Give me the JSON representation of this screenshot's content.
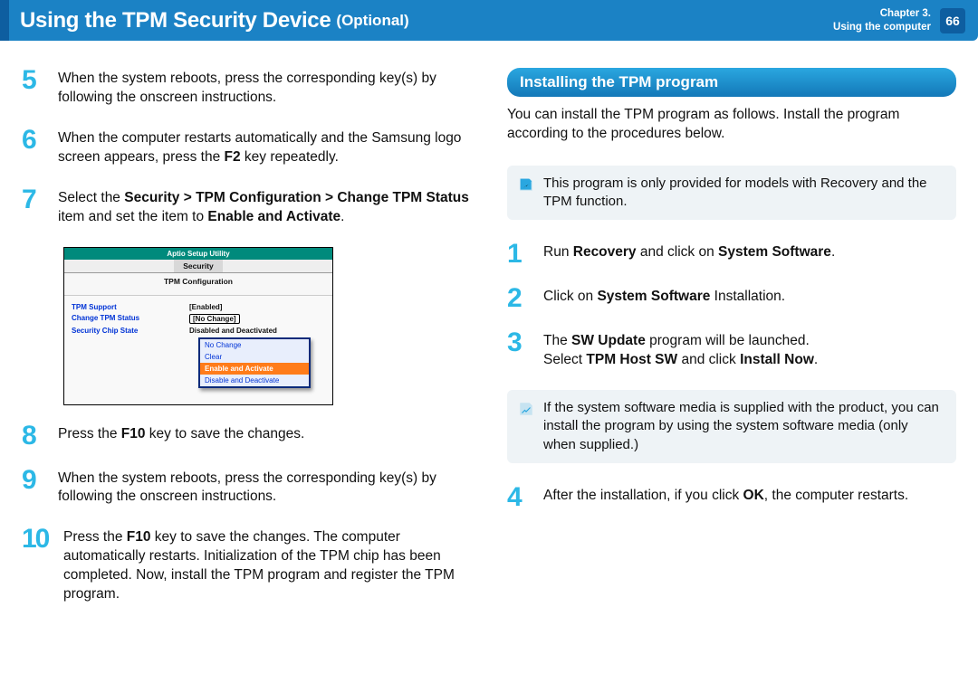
{
  "header": {
    "title": "Using the TPM Security Device",
    "subtitle": "(Optional)",
    "chapter_line1": "Chapter 3.",
    "chapter_line2": "Using the computer",
    "page_number": "66"
  },
  "left": {
    "step5": "When the system reboots, press the corresponding key(s) by following the onscreen instructions.",
    "step6_a": "When the computer restarts automatically and the Samsung logo screen appears, press the ",
    "step6_b": "F2",
    "step6_c": " key repeatedly.",
    "step7_a": "Select the ",
    "step7_b": "Security > TPM Configuration > Change TPM Status",
    "step7_c": " item and set the item to ",
    "step7_d": "Enable and Activate",
    "step7_e": ".",
    "step8_a": "Press the ",
    "step8_b": "F10",
    "step8_c": " key to save the changes.",
    "step9": "When the system reboots, press the corresponding key(s) by following the onscreen instructions.",
    "step10_a": "Press the ",
    "step10_b": "F10",
    "step10_c": " key to save the changes. The computer automatically restarts. Initialization of the TPM chip has been completed. Now, install the TPM program and register the TPM program."
  },
  "bios": {
    "util_title": "Aptio Setup Utility",
    "tab": "Security",
    "sub": "TPM Configuration",
    "r1l": "TPM Support",
    "r1v": "[Enabled]",
    "r2l": "Change TPM Status",
    "r2v": "[No Change]",
    "r3l": "Security Chip State",
    "r3v": "Disabled and Deactivated",
    "m1": "No Change",
    "m2": "Clear",
    "m3": "Enable and Activate",
    "m4": "Disable and Deactivate"
  },
  "right": {
    "section": "Installing the TPM program",
    "intro": "You can install the TPM program as follows. Install the program according to the procedures below.",
    "note1": "This program is only provided for models with Recovery  and the TPM function.",
    "step1_a": "Run ",
    "step1_b": "Recovery",
    "step1_c": " and click on ",
    "step1_d": "System Software",
    "step1_e": ".",
    "step2_a": "Click on ",
    "step2_b": "System Software",
    "step2_c": " Installation.",
    "step3_a": "The ",
    "step3_b": "SW Update",
    "step3_c": " program will be launched.",
    "step3_d": "Select ",
    "step3_e": "TPM Host SW",
    "step3_f": " and click ",
    "step3_g": "Install Now",
    "step3_h": ".",
    "note2": "If the system software media is supplied with the product, you can install the program by using the system software media (only when supplied.)",
    "step4_a": "After the installation, if you click ",
    "step4_b": "OK",
    "step4_c": ", the computer restarts."
  }
}
